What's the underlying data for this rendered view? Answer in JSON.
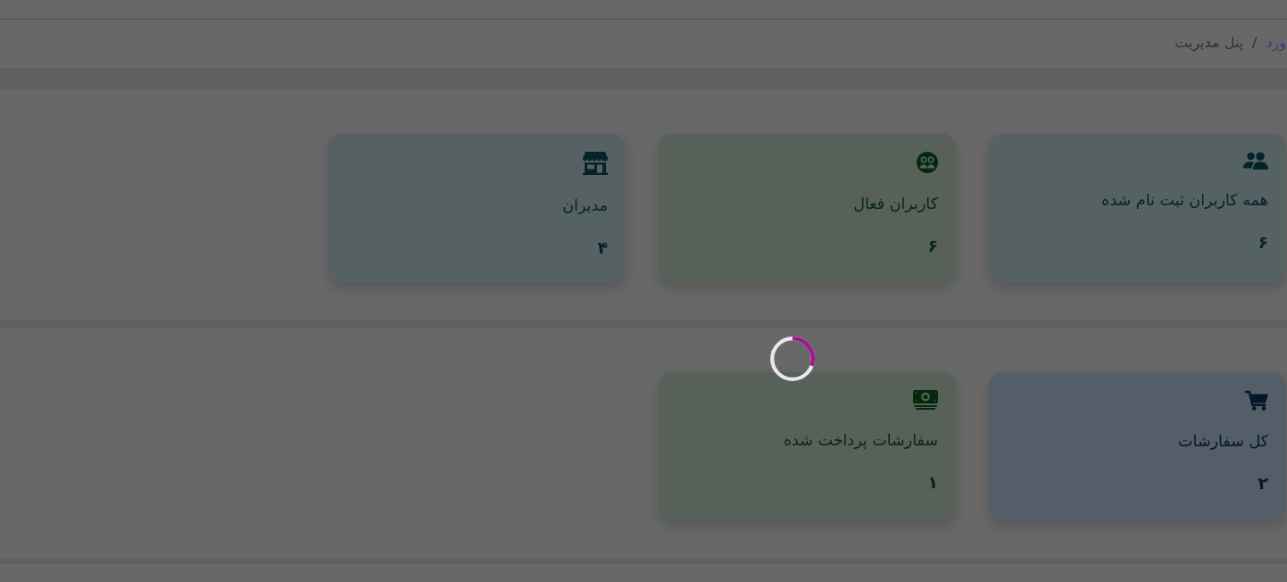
{
  "breadcrumb": {
    "items": [
      {
        "label": "ورد",
        "current": false
      },
      {
        "label": "پنل مدیریت",
        "current": true
      }
    ],
    "separator": "/"
  },
  "sections": [
    {
      "cards": [
        {
          "kind": "all_users",
          "color": "#566163",
          "label": "همه کاربران ثبت نام شده",
          "value": "۶"
        },
        {
          "kind": "active_users",
          "color": "#576159",
          "label": "کاربران فعال",
          "value": "۶"
        },
        {
          "kind": "admins",
          "color": "#566163",
          "label": "مدیران",
          "value": "۴"
        }
      ]
    },
    {
      "cards": [
        {
          "kind": "orders",
          "color": "#545e69",
          "label": "کل سفارشات",
          "value": "۲"
        },
        {
          "kind": "paid_orders",
          "color": "#576159",
          "label": "سفارشات پرداخت شده",
          "value": "۱"
        }
      ]
    }
  ],
  "loading": true
}
